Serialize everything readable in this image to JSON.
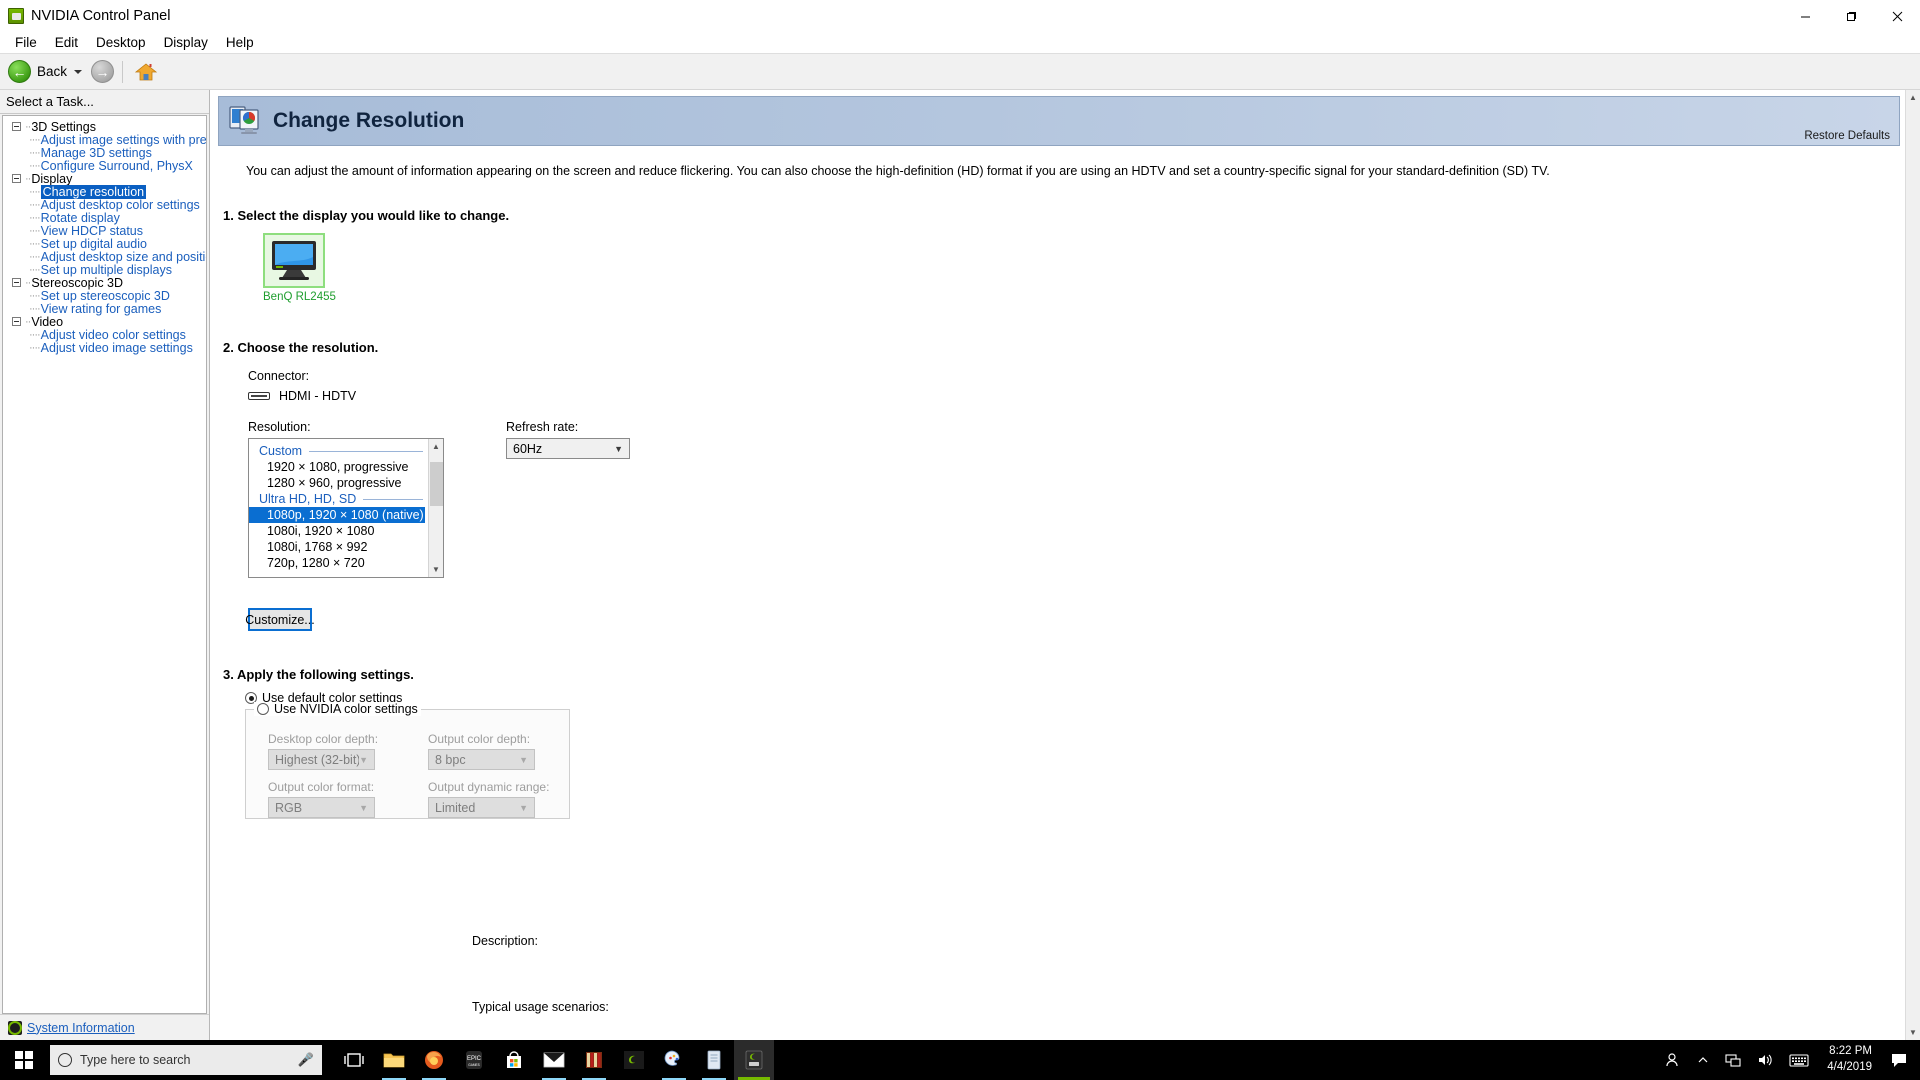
{
  "window": {
    "title": "NVIDIA Control Panel",
    "icon": "nvidia-icon",
    "minimize": "—",
    "maximize": "❐",
    "close": "✕"
  },
  "menubar": {
    "items": [
      {
        "label": "File"
      },
      {
        "label": "Edit"
      },
      {
        "label": "Desktop"
      },
      {
        "label": "Display"
      },
      {
        "label": "Help"
      }
    ]
  },
  "toolbar": {
    "back_label": "Back",
    "back_arrow": "←",
    "forward_arrow": "→",
    "home_icon": "home-icon"
  },
  "sidebar": {
    "header": "Select a Task...",
    "tree": [
      {
        "label": "3D Settings",
        "children": [
          "Adjust image settings with preview",
          "Manage 3D settings",
          "Configure Surround, PhysX"
        ]
      },
      {
        "label": "Display",
        "children": [
          "Change resolution",
          "Adjust desktop color settings",
          "Rotate display",
          "View HDCP status",
          "Set up digital audio",
          "Adjust desktop size and position",
          "Set up multiple displays"
        ]
      },
      {
        "label": "Stereoscopic 3D",
        "children": [
          "Set up stereoscopic 3D",
          "View rating for games"
        ]
      },
      {
        "label": "Video",
        "children": [
          "Adjust video color settings",
          "Adjust video image settings"
        ]
      }
    ],
    "selected": "Change resolution",
    "system_information": "System Information"
  },
  "page": {
    "title": "Change Resolution",
    "restore_defaults": "Restore Defaults",
    "intro": "You can adjust the amount of information appearing on the screen and reduce flickering. You can also choose the high-definition (HD) format if you are using an HDTV and set a country-specific signal for your standard-definition (SD) TV."
  },
  "step1": {
    "heading": "1. Select the display you would like to change.",
    "display_name": "BenQ RL2455"
  },
  "step2": {
    "heading": "2. Choose the resolution.",
    "connector_label": "Connector:",
    "connector_value": "HDMI - HDTV",
    "resolution_label": "Resolution:",
    "refresh_label": "Refresh rate:",
    "refresh_value": "60Hz",
    "customize_button": "Customize...",
    "resolution_list": [
      {
        "type": "group",
        "label": "Custom"
      },
      {
        "type": "option",
        "label": "1920 × 1080, progressive",
        "selected": false
      },
      {
        "type": "option",
        "label": "1280 × 960, progressive",
        "selected": false
      },
      {
        "type": "group",
        "label": "Ultra HD, HD, SD"
      },
      {
        "type": "option",
        "label": "1080p, 1920 × 1080 (native)",
        "selected": true
      },
      {
        "type": "option",
        "label": "1080i, 1920 × 1080",
        "selected": false
      },
      {
        "type": "option",
        "label": "1080i, 1768 × 992",
        "selected": false
      },
      {
        "type": "option",
        "label": "720p, 1280 × 720",
        "selected": false
      }
    ]
  },
  "step3": {
    "heading": "3. Apply the following settings.",
    "radio_default": "Use default color settings",
    "radio_nvidia": "Use NVIDIA color settings",
    "selected_radio": "default",
    "fields": [
      {
        "label": "Desktop color depth:",
        "value": "Highest (32-bit)"
      },
      {
        "label": "Output color depth:",
        "value": "8 bpc"
      },
      {
        "label": "Output color format:",
        "value": "RGB"
      },
      {
        "label": "Output dynamic range:",
        "value": "Limited"
      }
    ]
  },
  "right_column": {
    "description_label": "Description:",
    "usage_label": "Typical usage scenarios:"
  },
  "taskbar": {
    "search_placeholder": "Type here to search",
    "icons": [
      "task-view-icon",
      "file-explorer-icon",
      "firefox-icon",
      "epic-games-icon",
      "microsoft-store-icon",
      "mail-icon",
      "winrar-icon",
      "nvidia-geforce-icon",
      "paint-icon",
      "notepad-icon",
      "nvidia-control-panel-icon"
    ],
    "tray": {
      "people_icon": "people-icon",
      "chevron_icon": "show-hidden-icons-icon",
      "network_icon": "network-icon",
      "volume_icon": "volume-icon",
      "keyboard_icon": "keyboard-icon",
      "action_center_icon": "action-center-icon"
    },
    "clock": {
      "time": "8:22 PM",
      "date": "4/4/2019"
    }
  },
  "colors": {
    "accent_blue": "#0a6ed1",
    "link_blue": "#1b5fbd",
    "nvidia_green": "#76b900",
    "banner_from": "#a7bcd8",
    "banner_to": "#c8d5e8"
  }
}
